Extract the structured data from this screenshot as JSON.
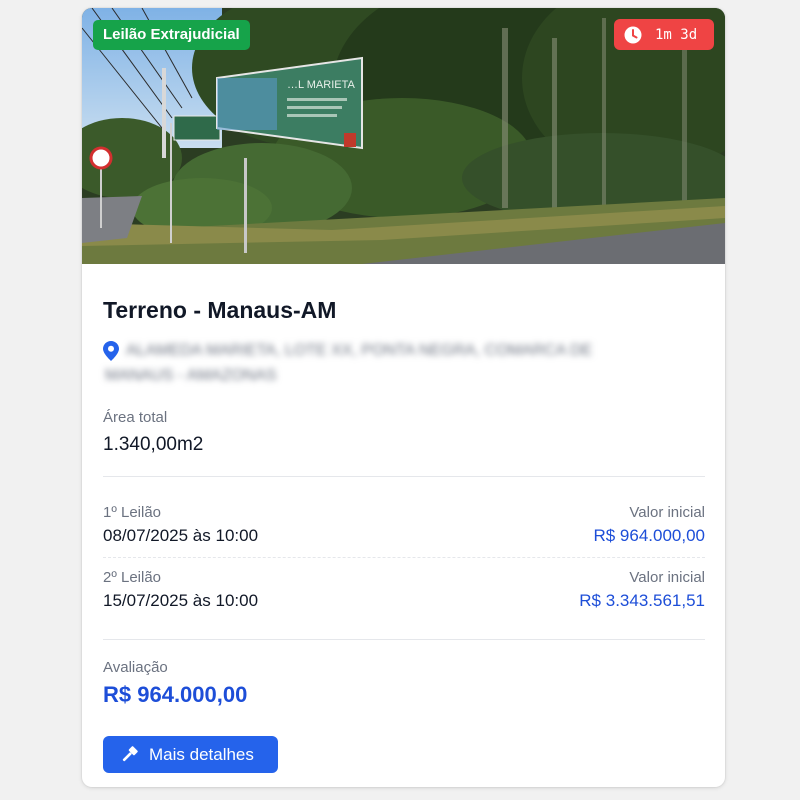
{
  "listing": {
    "type_badge": "Leilão Extrajudicial",
    "timer": {
      "icon": "clock-icon",
      "text": "1m 3d"
    },
    "photo": {
      "sign_text": "…L MARIETA"
    },
    "title": "Terreno - Manaus-AM",
    "address": {
      "icon": "map-pin-icon",
      "line1": "ALAMEDA MARIETA, LOTE XX, PONTA NEGRA, COMARCA DE",
      "line2": "MANAUS - AMAZONAS"
    },
    "area": {
      "label": "Área total",
      "value": "1.340,00m2"
    },
    "auctions": [
      {
        "label": "1º Leilão",
        "date": "08/07/2025 às 10:00",
        "value_label": "Valor inicial",
        "value": "R$ 964.000,00"
      },
      {
        "label": "2º Leilão",
        "date": "15/07/2025 às 10:00",
        "value_label": "Valor inicial",
        "value": "R$ 3.343.561,51"
      }
    ],
    "appraisal": {
      "label": "Avaliação",
      "value": "R$ 964.000,00"
    },
    "details_button": {
      "label": "Mais detalhes",
      "icon": "gavel-icon"
    }
  },
  "colors": {
    "type_badge": "#16a34a",
    "timer_badge": "#ef4444",
    "accent": "#2563eb",
    "value_text": "#1d4ed8"
  }
}
